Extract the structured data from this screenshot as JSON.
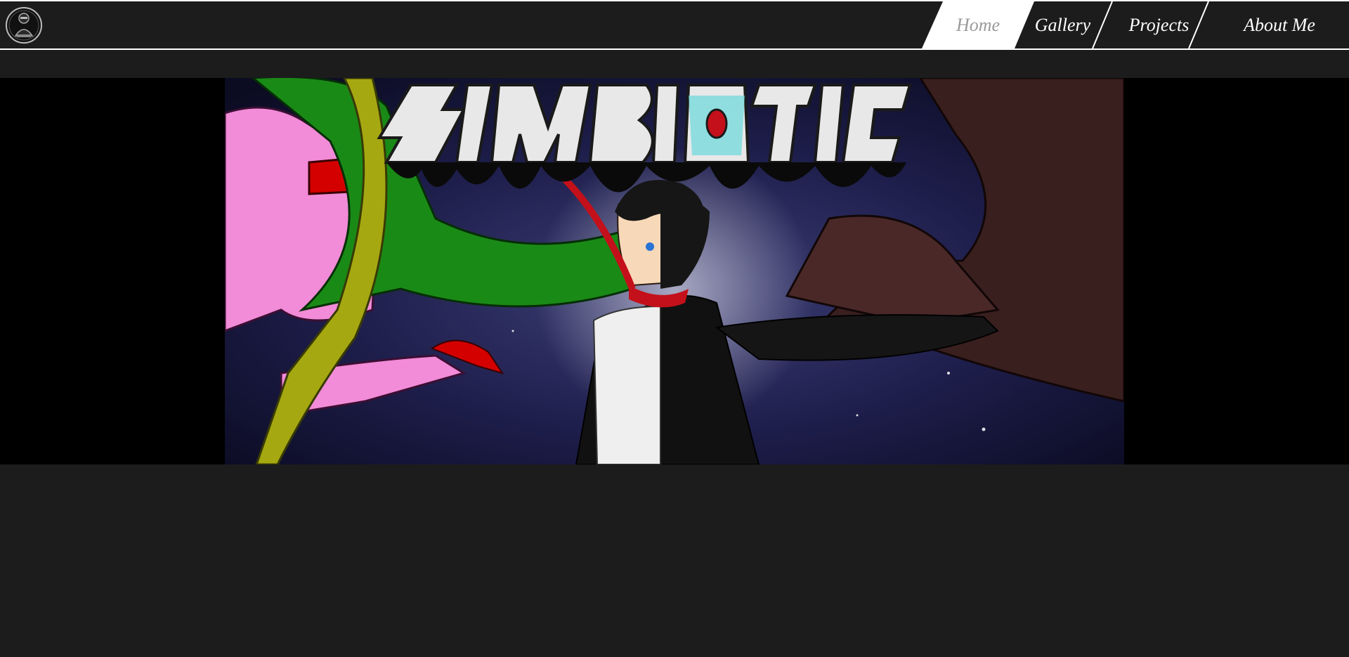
{
  "site": {
    "logo_icon": "robot-emblem-icon"
  },
  "nav": {
    "items": [
      {
        "label": "Home",
        "active": true
      },
      {
        "label": "Gallery",
        "active": false
      },
      {
        "label": "Projects",
        "active": false
      },
      {
        "label": "About Me",
        "active": false
      }
    ]
  },
  "banner": {
    "title_art": "SYMBIOTIC",
    "image": "symbiotic-banner-artwork"
  },
  "colors": {
    "background": "#1c1c1c",
    "nav_active_bg": "#ffffff",
    "nav_active_text": "#9a9a9a",
    "nav_text": "#ffffff",
    "banner_side": "#000000"
  }
}
